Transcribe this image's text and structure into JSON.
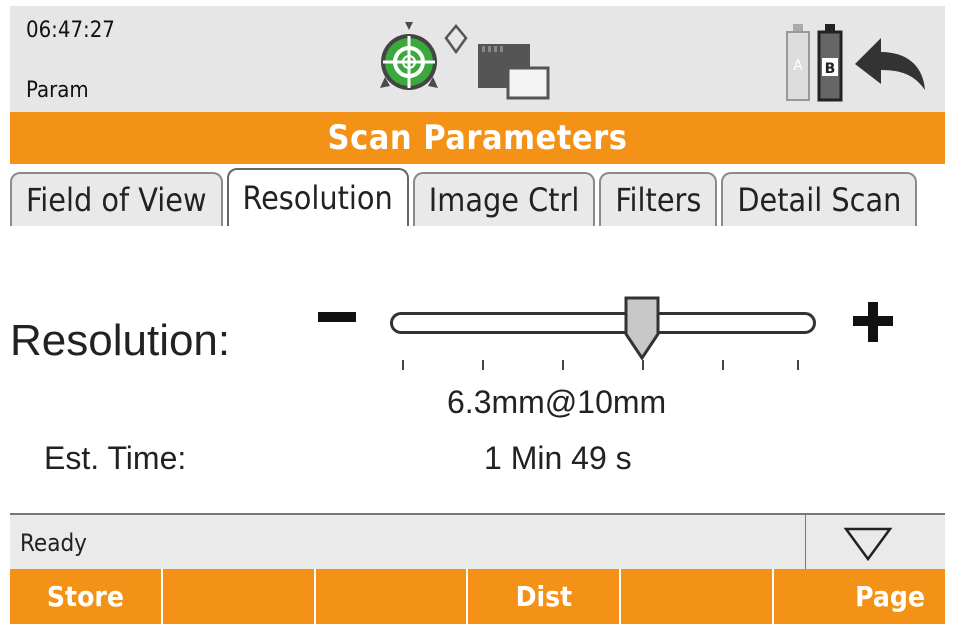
{
  "status": {
    "time": "06:47:27",
    "mode": "Param"
  },
  "battery": {
    "a_label": "A",
    "b_label": "B"
  },
  "title": "Scan Parameters",
  "tabs": [
    {
      "label": "Field of View"
    },
    {
      "label": "Resolution"
    },
    {
      "label": "Image Ctrl"
    },
    {
      "label": "Filters"
    },
    {
      "label": "Detail Scan"
    }
  ],
  "resolution": {
    "label": "Resolution:",
    "value_text": "6.3mm@10mm",
    "slider_position": 0.6,
    "tick_count": 6
  },
  "est_time": {
    "label": "Est. Time:",
    "value": "1 Min 49 s"
  },
  "status_line": {
    "text": "Ready"
  },
  "softkeys": [
    {
      "label": "Store"
    },
    {
      "label": ""
    },
    {
      "label": ""
    },
    {
      "label": "Dist"
    },
    {
      "label": ""
    },
    {
      "label": "Page"
    }
  ],
  "colors": {
    "accent": "#f39217",
    "bar_bg": "#e6e6e6",
    "target_green": "#3aa83a"
  },
  "icons": [
    "target-icon",
    "prism-icon",
    "memory-card-icon",
    "battery-a-icon",
    "battery-b-icon",
    "back-arrow-icon",
    "dropdown-triangle-icon"
  ]
}
